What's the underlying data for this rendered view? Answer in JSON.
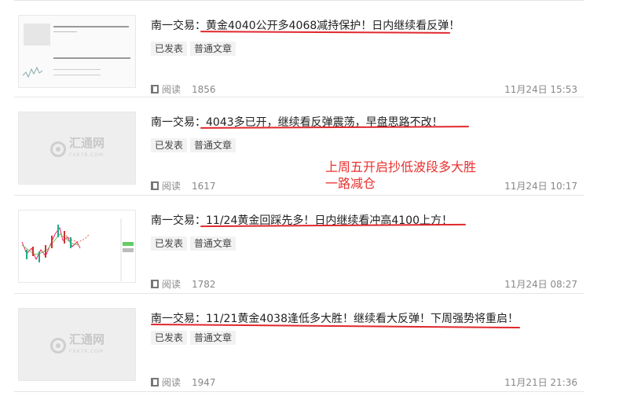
{
  "articles": [
    {
      "prefix": "南一交易：",
      "headline": "黄金4040公开多4068减持保护！日内继续看反弹！",
      "tags": [
        "已发表",
        "普通文章"
      ],
      "reads_label": "阅读",
      "reads": "1856",
      "date": "11月24日 15:53",
      "thumb": "document-snapshot"
    },
    {
      "prefix": "南一交易：",
      "headline": "4043多已开，继续看反弹震荡，早盘思路不改！",
      "tags": [
        "已发表",
        "普通文章"
      ],
      "reads_label": "阅读",
      "reads": "1617",
      "date": "11月24日 10:17",
      "thumb": "placeholder"
    },
    {
      "prefix": "南一交易：",
      "headline": "11/24黄金回踩先多！日内继续看冲高4100上方！",
      "tags": [
        "已发表",
        "普通文章"
      ],
      "reads_label": "阅读",
      "reads": "1782",
      "date": "11月24日 08:27",
      "thumb": "candlestick-chart"
    },
    {
      "prefix": "南一交易：",
      "headline": "11/21黄金4038逢低多大胜！继续看大反弹！下周强势将重启！",
      "tags": [
        "已发表",
        "普通文章"
      ],
      "reads_label": "阅读",
      "reads": "1947",
      "date": "11月21日 21:36",
      "thumb": "placeholder"
    }
  ],
  "watermark": {
    "name": "汇通网",
    "sub": "FX678.COM"
  },
  "annotation": {
    "line1": "上周五开启抄低波段多大胜",
    "line2": "一路减仓"
  },
  "colors": {
    "annotation": "#e8322f",
    "underline": "#e0282e"
  },
  "doc_thumb": {
    "line_a": "南一交易：4040多已开，继续看反弹震荡，早盘思路不改！",
    "line_b": "南一交易：11/24黄金回踩先多！日内继续看冲高4100上方！"
  }
}
